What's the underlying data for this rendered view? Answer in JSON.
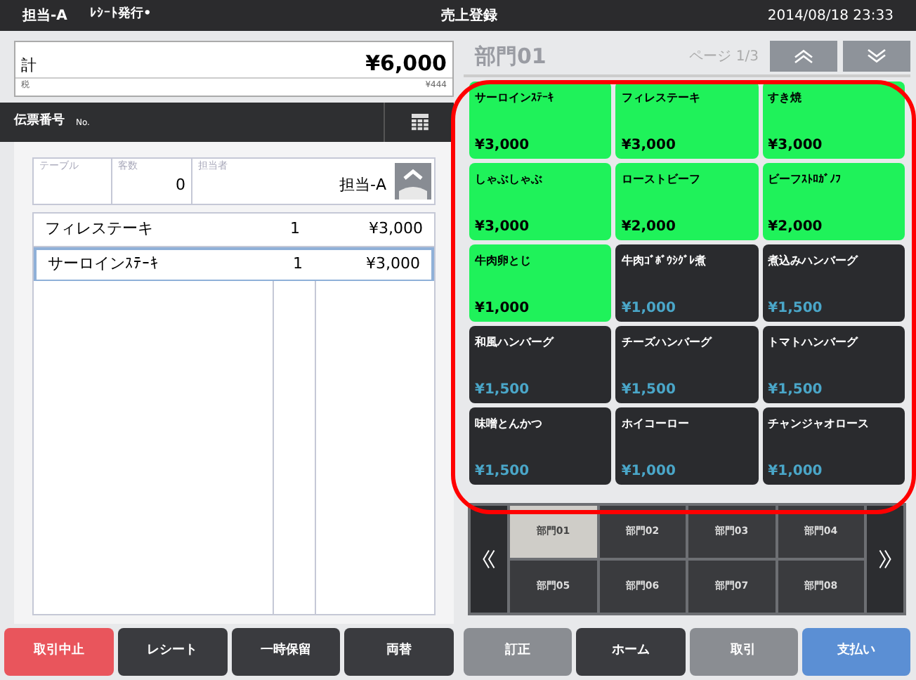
{
  "top_bar": {
    "operator": "担当-A",
    "receipt": "ﾚｼｰﾄ発行•",
    "title": "売上登録",
    "datetime": "2014/08/18 23:33"
  },
  "total": {
    "label": "計",
    "amount": "¥6,000",
    "tax_label": "税",
    "tax": "¥444"
  },
  "slip": {
    "label": "伝票番号",
    "no": "No."
  },
  "info": {
    "table_label": "テーブル",
    "guests_label": "客数",
    "guests": "0",
    "staff_label": "担当者",
    "staff": "担当-A"
  },
  "order_rows": [
    {
      "name": "フィレステーキ",
      "qty": "1",
      "price": "¥3,000",
      "selected": false
    },
    {
      "name": "サーロインｽﾃｰｷ",
      "qty": "1",
      "price": "¥3,000",
      "selected": true
    }
  ],
  "left_buttons": [
    {
      "label": "取引中止",
      "kind": "danger"
    },
    {
      "label": "レシート",
      "kind": "dark"
    },
    {
      "label": "一時保留",
      "kind": "dark"
    },
    {
      "label": "両替",
      "kind": "dark"
    }
  ],
  "menu": {
    "category": "部門01",
    "page": "ページ 1/3"
  },
  "items": [
    {
      "name": "サーロインｽﾃｰｷ",
      "price": "¥3,000",
      "highlighted": true
    },
    {
      "name": "フィレステーキ",
      "price": "¥3,000",
      "highlighted": true
    },
    {
      "name": "すき焼",
      "price": "¥3,000",
      "highlighted": true
    },
    {
      "name": "しゃぶしゃぶ",
      "price": "¥3,000",
      "highlighted": true
    },
    {
      "name": "ローストビーフ",
      "price": "¥2,000",
      "highlighted": true
    },
    {
      "name": "ビーフｽﾄﾛｶﾞﾉﾌ",
      "price": "¥2,000",
      "highlighted": true
    },
    {
      "name": "牛肉卵とじ",
      "price": "¥1,000",
      "highlighted": true
    },
    {
      "name": "牛肉ｺﾞﾎﾞｳｼｸﾞﾚ煮",
      "price": "¥1,000",
      "highlighted": false
    },
    {
      "name": "煮込みハンバーグ",
      "price": "¥1,500",
      "highlighted": false
    },
    {
      "name": "和風ハンバーグ",
      "price": "¥1,500",
      "highlighted": false
    },
    {
      "name": "チーズハンバーグ",
      "price": "¥1,500",
      "highlighted": false
    },
    {
      "name": "トマトハンバーグ",
      "price": "¥1,500",
      "highlighted": false
    },
    {
      "name": "味噌とんかつ",
      "price": "¥1,500",
      "highlighted": false
    },
    {
      "name": "ホイコーロー",
      "price": "¥1,000",
      "highlighted": false
    },
    {
      "name": "チャンジャオロース",
      "price": "¥1,000",
      "highlighted": false
    }
  ],
  "categories": [
    {
      "label": "部門01",
      "selected": true
    },
    {
      "label": "部門02",
      "selected": false
    },
    {
      "label": "部門03",
      "selected": false
    },
    {
      "label": "部門04",
      "selected": false
    },
    {
      "label": "部門05",
      "selected": false
    },
    {
      "label": "部門06",
      "selected": false
    },
    {
      "label": "部門07",
      "selected": false
    },
    {
      "label": "部門08",
      "selected": false
    }
  ],
  "right_buttons": [
    {
      "label": "訂正",
      "kind": "grey"
    },
    {
      "label": "ホーム",
      "kind": "dark"
    },
    {
      "label": "取引",
      "kind": "grey"
    },
    {
      "label": "支払い",
      "kind": "primary"
    }
  ]
}
